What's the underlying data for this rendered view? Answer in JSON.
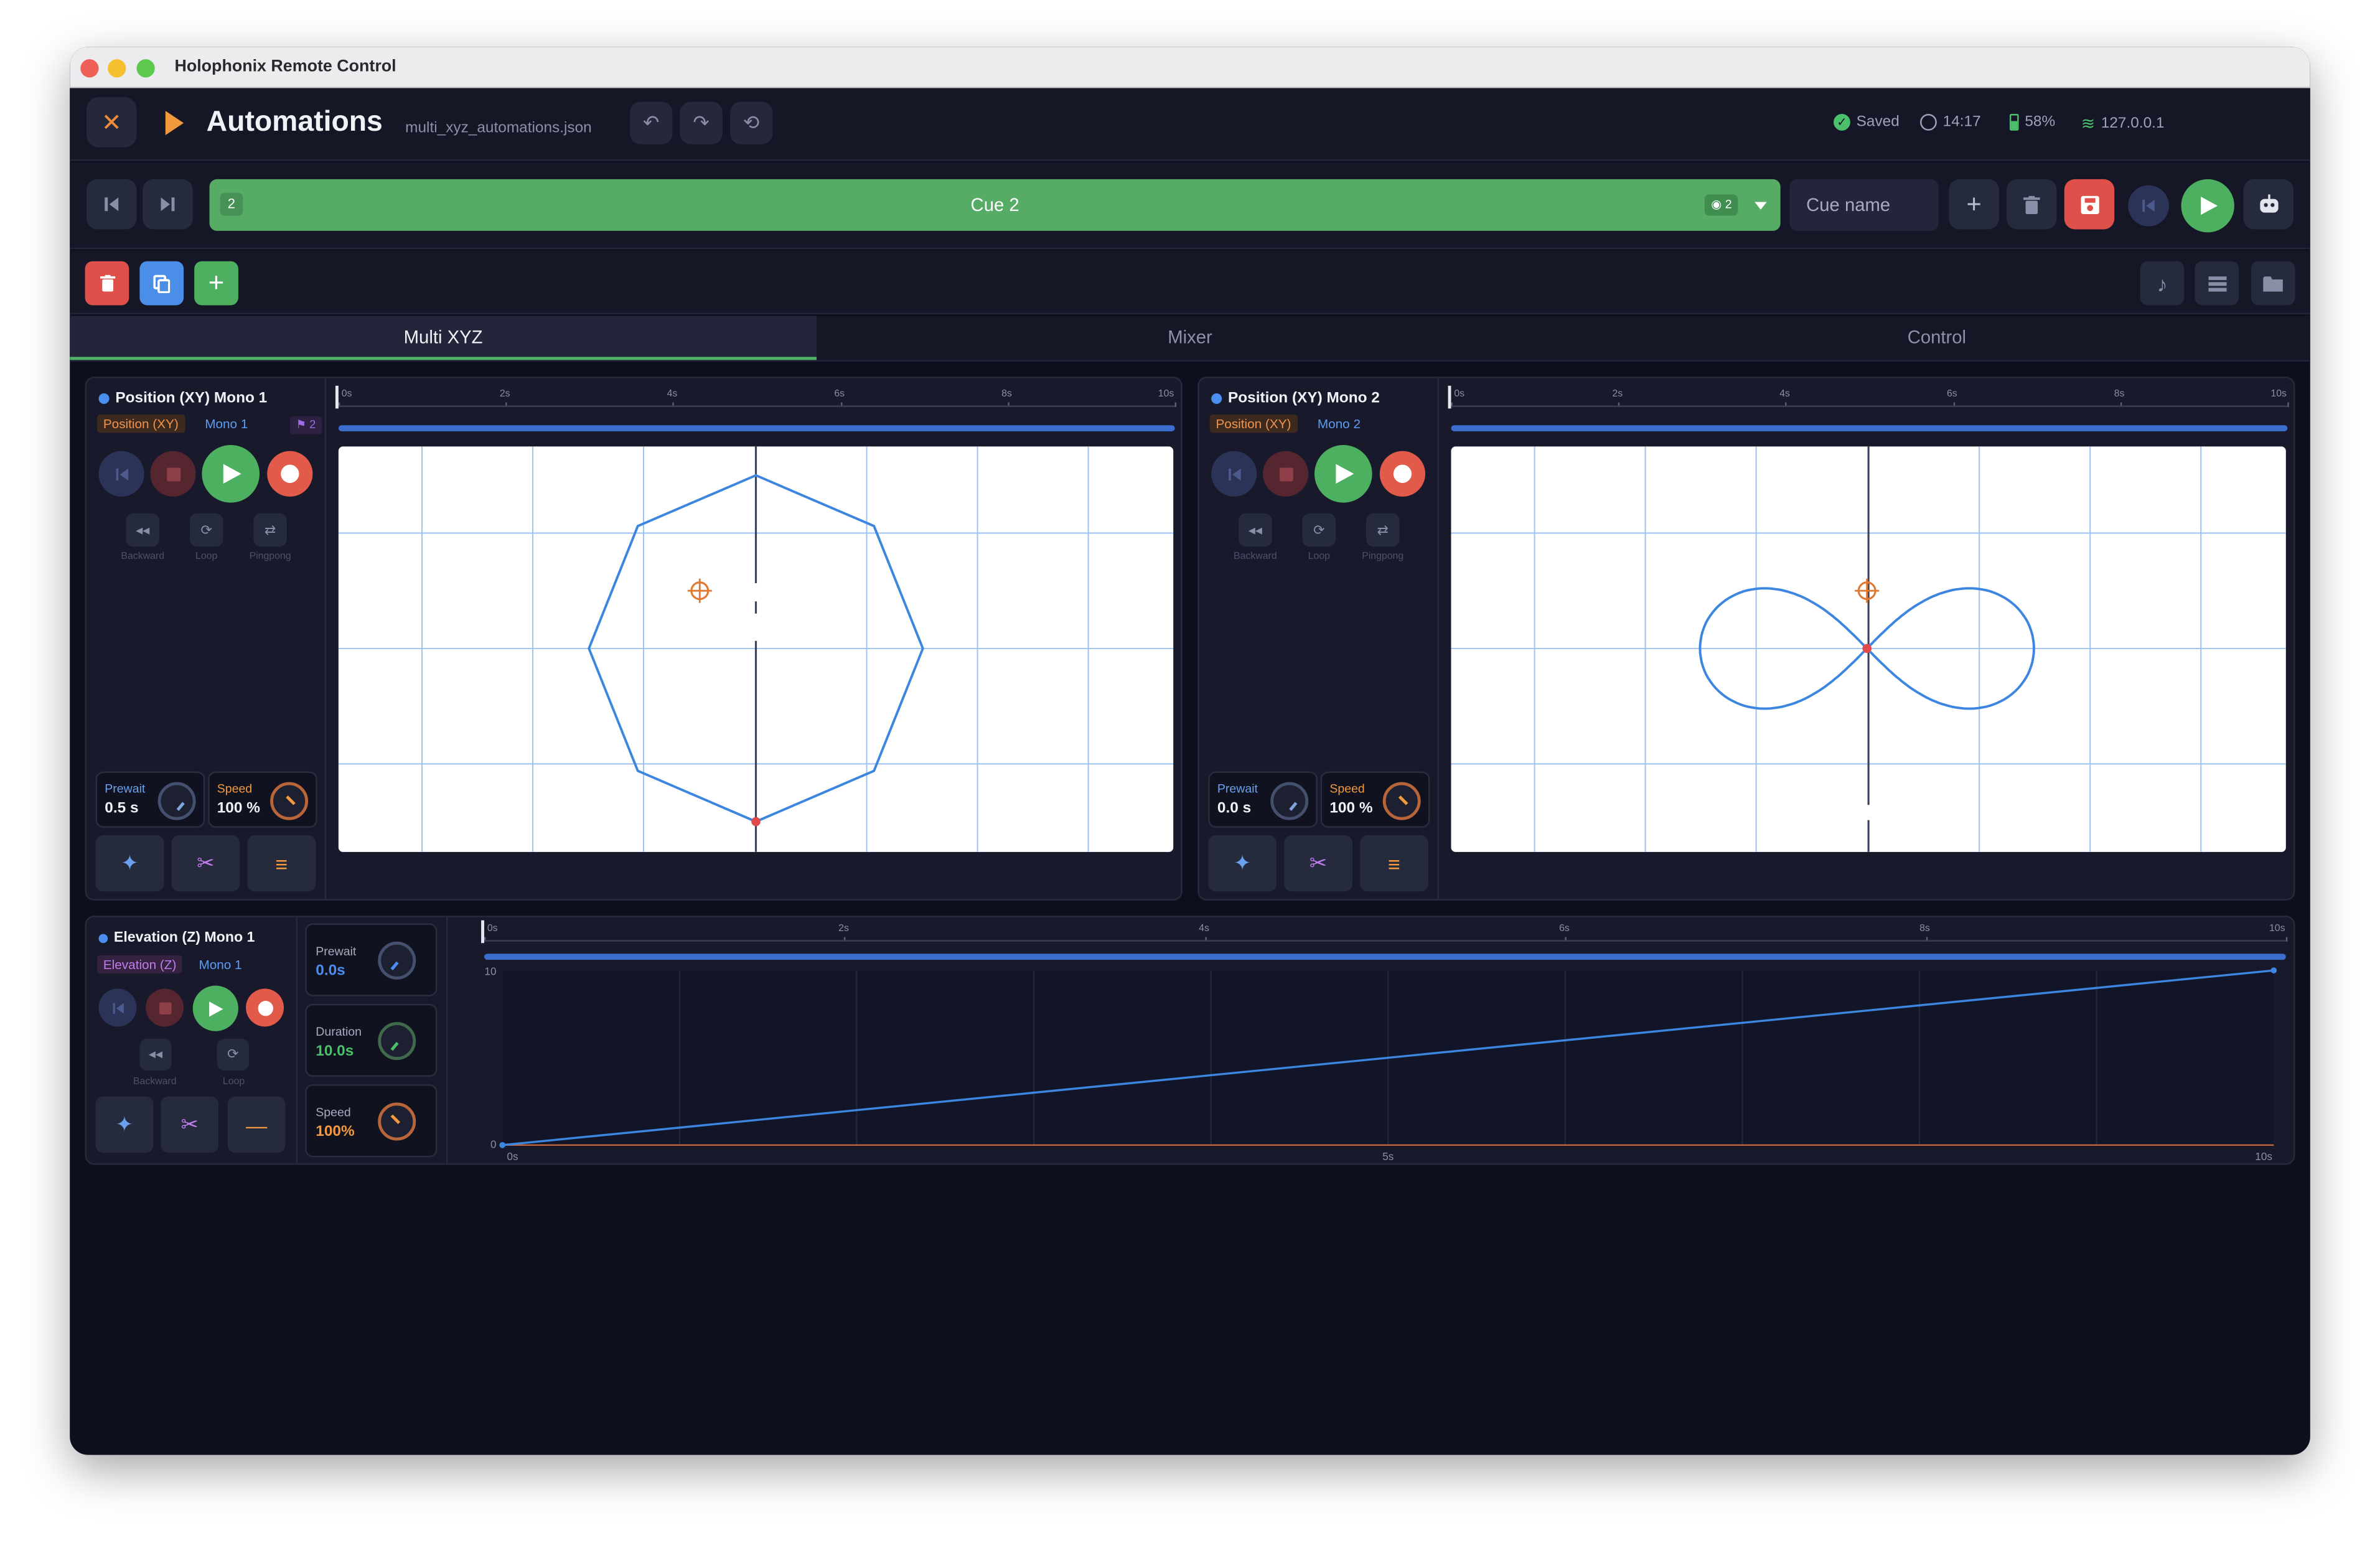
{
  "window": {
    "title": "Holophonix Remote Control"
  },
  "header": {
    "title": "Automations",
    "filename": "multi_xyz_automations.json",
    "status": {
      "saved": "Saved",
      "time": "14:17",
      "battery": "58%",
      "ip": "127.0.0.1"
    }
  },
  "cue": {
    "number": "2",
    "name": "Cue 2",
    "badge": "2",
    "name_placeholder": "Cue name"
  },
  "tabs": [
    "Multi XYZ",
    "Mixer",
    "Control"
  ],
  "panels": [
    {
      "title": "Position (XY) Mono 1",
      "type_tag": "Position (XY)",
      "track": "Mono 1",
      "marker_badge": "2",
      "buttons": {
        "backward": "Backward",
        "loop": "Loop",
        "pingpong": "Pingpong"
      },
      "prewait": {
        "label": "Prewait",
        "value": "0.5 s"
      },
      "speed": {
        "label": "Speed",
        "value": "100 %"
      },
      "ruler": [
        "0s",
        "2s",
        "4s",
        "6s",
        "8s",
        "10s"
      ],
      "shape": "octagon"
    },
    {
      "title": "Position (XY) Mono 2",
      "type_tag": "Position (XY)",
      "track": "Mono 2",
      "buttons": {
        "backward": "Backward",
        "loop": "Loop",
        "pingpong": "Pingpong"
      },
      "prewait": {
        "label": "Prewait",
        "value": "0.0 s"
      },
      "speed": {
        "label": "Speed",
        "value": "100 %"
      },
      "ruler": [
        "0s",
        "2s",
        "4s",
        "6s",
        "8s",
        "10s"
      ],
      "shape": "lemniscate"
    }
  ],
  "elevation": {
    "title": "Elevation (Z) Mono 1",
    "type_tag": "Elevation (Z)",
    "track": "Mono 1",
    "buttons": {
      "backward": "Backward",
      "loop": "Loop"
    },
    "prewait": {
      "label": "Prewait",
      "value": "0.0s"
    },
    "duration": {
      "label": "Duration",
      "value": "10.0s"
    },
    "speed": {
      "label": "Speed",
      "value": "100%"
    },
    "ruler": [
      "0s",
      "2s",
      "4s",
      "6s",
      "8s",
      "10s"
    ],
    "y_ticks": [
      "10",
      "0"
    ],
    "x_ticks": [
      "0s",
      "5s",
      "10s"
    ]
  },
  "chart_data": {
    "type": "line",
    "x": [
      0,
      10
    ],
    "y": [
      0,
      10
    ],
    "xlim": [
      0,
      10
    ],
    "ylim": [
      0,
      10
    ]
  },
  "colors": {
    "accent_green": "#56ab65",
    "curve_blue": "#3c86e0",
    "record_red": "#e25a4a",
    "orange": "#f2993e"
  }
}
